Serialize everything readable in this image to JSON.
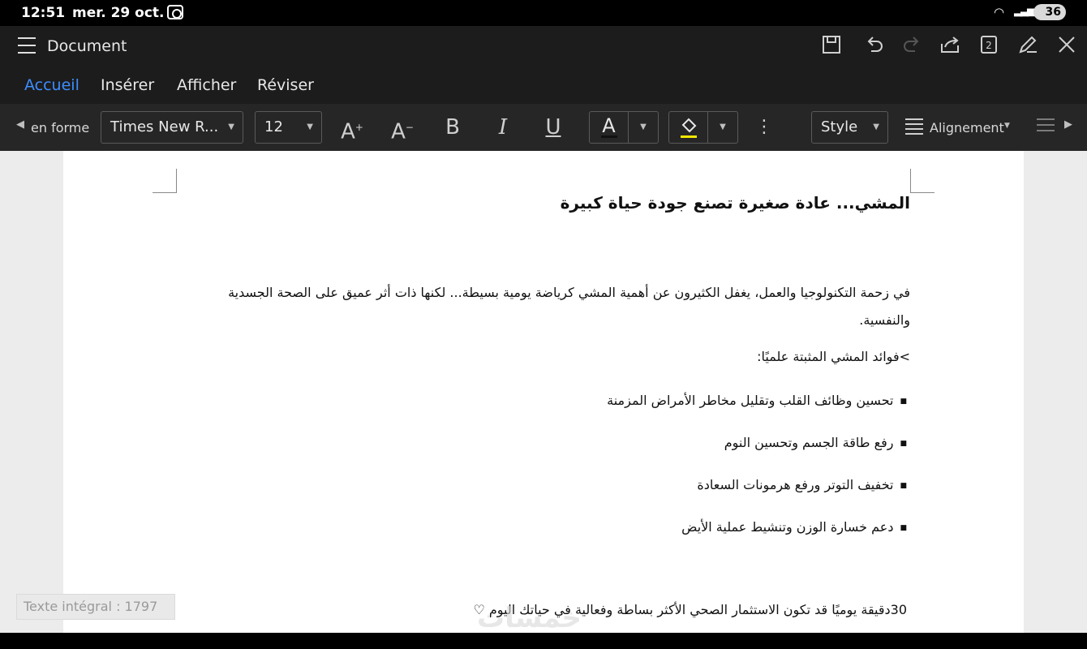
{
  "status": {
    "time": "12:51",
    "date": "mer. 29 oct.",
    "battery": "36"
  },
  "titlebar": {
    "title": "Document",
    "page_count": "2"
  },
  "tabs": [
    {
      "label": "Accueil",
      "active": true
    },
    {
      "label": "Insérer",
      "active": false
    },
    {
      "label": "Afficher",
      "active": false
    },
    {
      "label": "Réviser",
      "active": false
    }
  ],
  "toolbar": {
    "format_label": "en forme",
    "font": "Times New R...",
    "size": "12",
    "style": "Style",
    "alignment": "Alignement",
    "text_color": "#000000",
    "highlight_color": "#f5e600"
  },
  "document": {
    "heading": "المشي... عادة صغيرة تصنع جودة حياة كبيرة",
    "paragraph": "في زحمة التكنولوجيا والعمل، يغفل الكثيرون عن أهمية المشي كرياضة يومية بسيطة... لكنها ذات أثر عميق على الصحة الجسدية والنفسية.",
    "subhead": ">فوائد المشي المثبتة علميًا:",
    "bullets": [
      "تحسين وظائف القلب وتقليل مخاطر الأمراض المزمنة",
      "رفع طاقة الجسم وتحسين النوم",
      "تخفيف التوتر ورفع هرمونات السعادة",
      "دعم خسارة الوزن وتنشيط عملية الأيض"
    ],
    "closing": "30دقيقة يوميًا قد تكون الاستثمار الصحي الأكثر بساطة وفعالية في حياتك اليوم ♡"
  },
  "footer": {
    "word_count": "Texte intégral : 1797",
    "watermark": "خمسات"
  }
}
